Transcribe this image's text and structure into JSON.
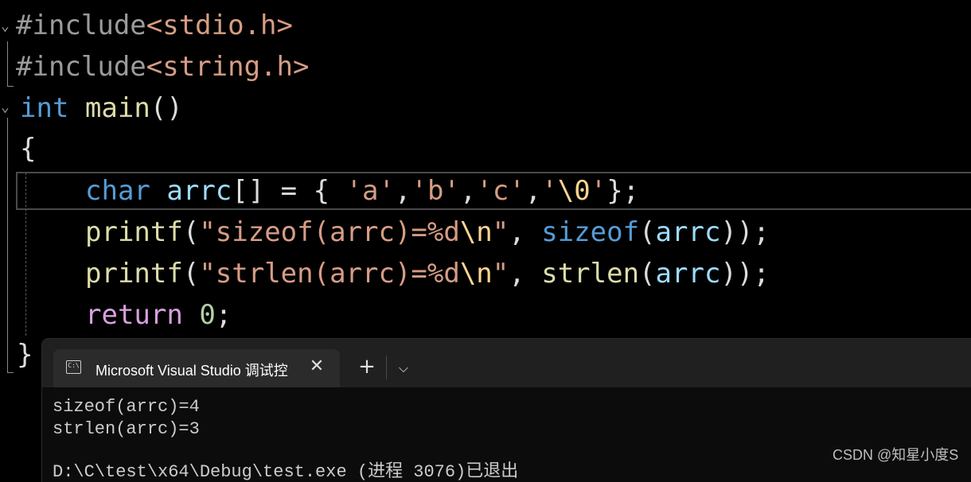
{
  "editor": {
    "line1": {
      "directive": "#include",
      "header": "<stdio.h>"
    },
    "line2": {
      "directive": "#include",
      "header": "<string.h>"
    },
    "line3": {
      "type": "int",
      "name": "main",
      "parens": "()"
    },
    "line4": {
      "brace": "{"
    },
    "line5": {
      "keyword": "char",
      "var": "arrc",
      "rest_a": "[] = { ",
      "c1": "'a'",
      "comma1": ",",
      "c2": "'b'",
      "comma2": ",",
      "c3": "'c'",
      "comma3": ",",
      "c4_open": "'",
      "c4_escape": "\\0",
      "c4_close": "'",
      "end": "};"
    },
    "line6": {
      "fn": "printf",
      "open": "(",
      "str_a": "\"sizeof(arrc)=%d",
      "esc": "\\n",
      "str_b": "\"",
      "comma": ", ",
      "op": "sizeof",
      "open2": "(",
      "var": "arrc",
      "close": "));"
    },
    "line7": {
      "fn": "printf",
      "open": "(",
      "str_a": "\"strlen(arrc)=%d",
      "esc": "\\n",
      "str_b": "\"",
      "comma": ", ",
      "fn2": "strlen",
      "open2": "(",
      "var": "arrc",
      "close": "));"
    },
    "line8": {
      "keyword": "return",
      "space": " ",
      "num": "0",
      "end": ";"
    },
    "line9": {
      "brace": "}"
    }
  },
  "console": {
    "tab_title": "Microsoft Visual Studio 调试控",
    "tab_icon_text": "C:\\",
    "close_glyph": "✕",
    "new_tab_glyph": "+",
    "dropdown_glyph": "⌵",
    "output_line1": "sizeof(arrc)=4",
    "output_line2": "strlen(arrc)=3",
    "partial_line": "D:\\C\\test\\x64\\Debug\\test.exe (进程 3076)已退出"
  },
  "watermark": "CSDN @知星小度S",
  "icons": {
    "fold_open_1": "chevron-down-icon",
    "fold_open_2": "chevron-down-icon",
    "tab_icon": "terminal-icon",
    "close": "close-icon",
    "new_tab": "plus-icon",
    "dropdown": "chevron-down-icon"
  }
}
